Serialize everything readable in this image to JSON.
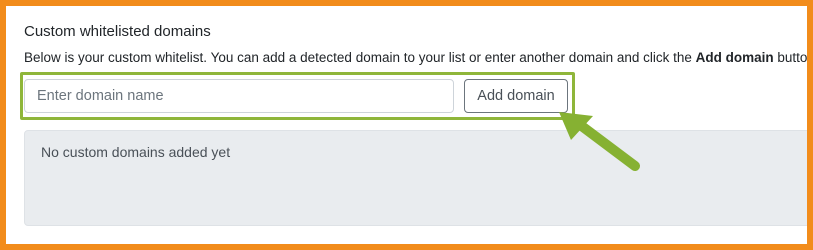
{
  "section": {
    "title": "Custom whitelisted domains",
    "description_prefix": "Below is your custom whitelist. You can add a detected domain to your list or enter another domain and click the ",
    "description_bold": "Add domain",
    "description_suffix": " button."
  },
  "form": {
    "domain_input_placeholder": "Enter domain name",
    "domain_input_value": "",
    "add_button_label": "Add domain"
  },
  "list": {
    "empty_message": "No custom domains added yet"
  },
  "colors": {
    "frame_border": "#f28c1b",
    "highlight": "#8fb63a",
    "arrow": "#86b132",
    "list_background": "#e9ecef"
  },
  "annotations": {
    "arrow_icon": "arrow-pointer-icon"
  }
}
